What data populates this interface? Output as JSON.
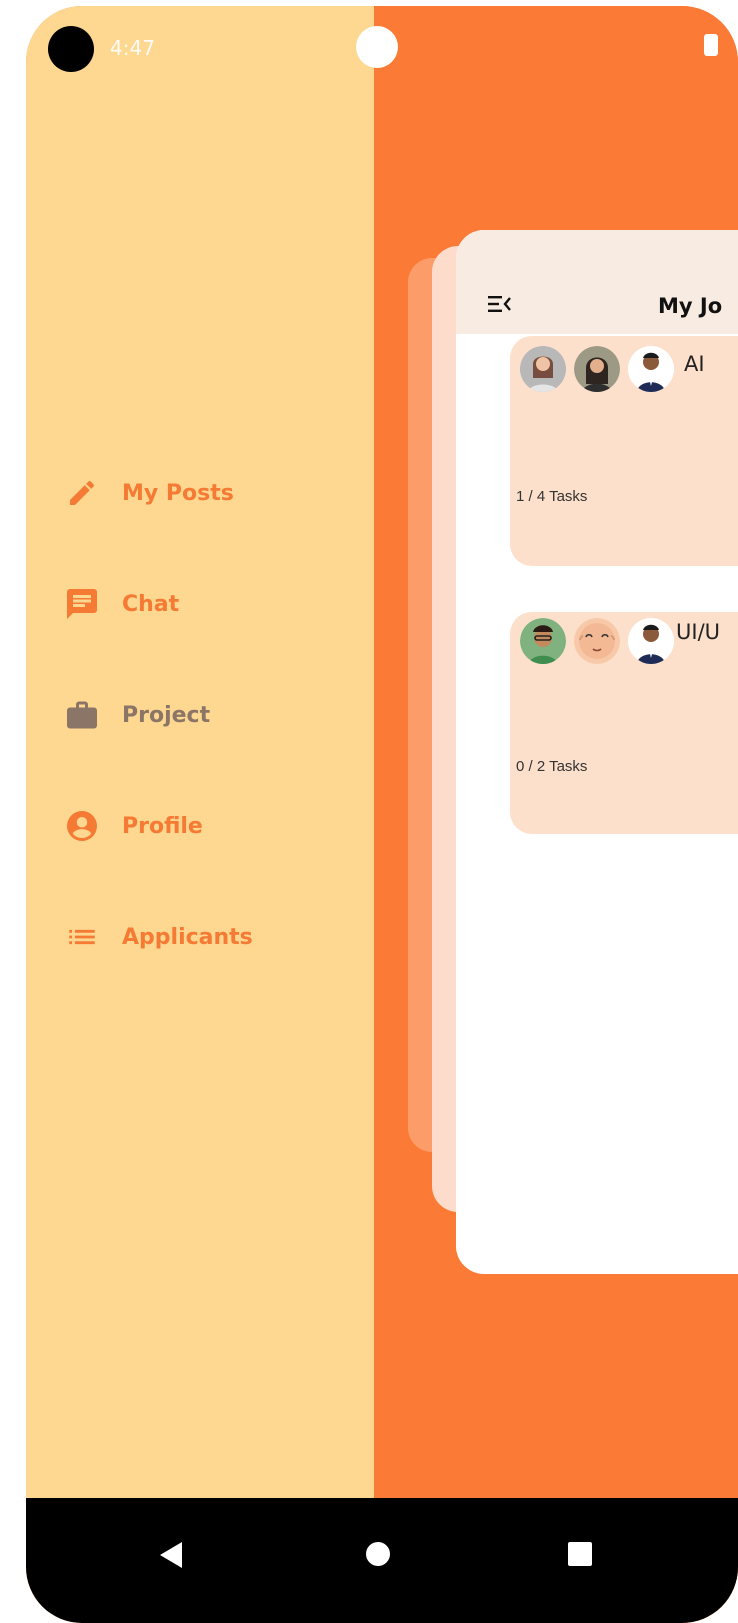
{
  "status": {
    "time": "4:47"
  },
  "drawer": {
    "items": [
      {
        "label": "My Posts",
        "icon": "pencil-icon",
        "active": true
      },
      {
        "label": "Chat",
        "icon": "chat-icon",
        "active": true
      },
      {
        "label": "Project",
        "icon": "briefcase-icon",
        "active": false
      },
      {
        "label": "Profile",
        "icon": "profile-icon",
        "active": true
      },
      {
        "label": "Applicants",
        "icon": "list-icon",
        "active": true
      }
    ]
  },
  "app": {
    "title": "My Jo",
    "jobs": [
      {
        "name": "AI",
        "tasks": "1 / 4 Tasks"
      },
      {
        "name": "UI/U",
        "tasks": "0 / 2 Tasks"
      }
    ]
  },
  "colors": {
    "drawer_bg": "#fed791",
    "accent": "#fb7a35",
    "menu_text": "#f57a34",
    "inactive_text": "#8b7567",
    "card_bg": "#fde0cb"
  }
}
